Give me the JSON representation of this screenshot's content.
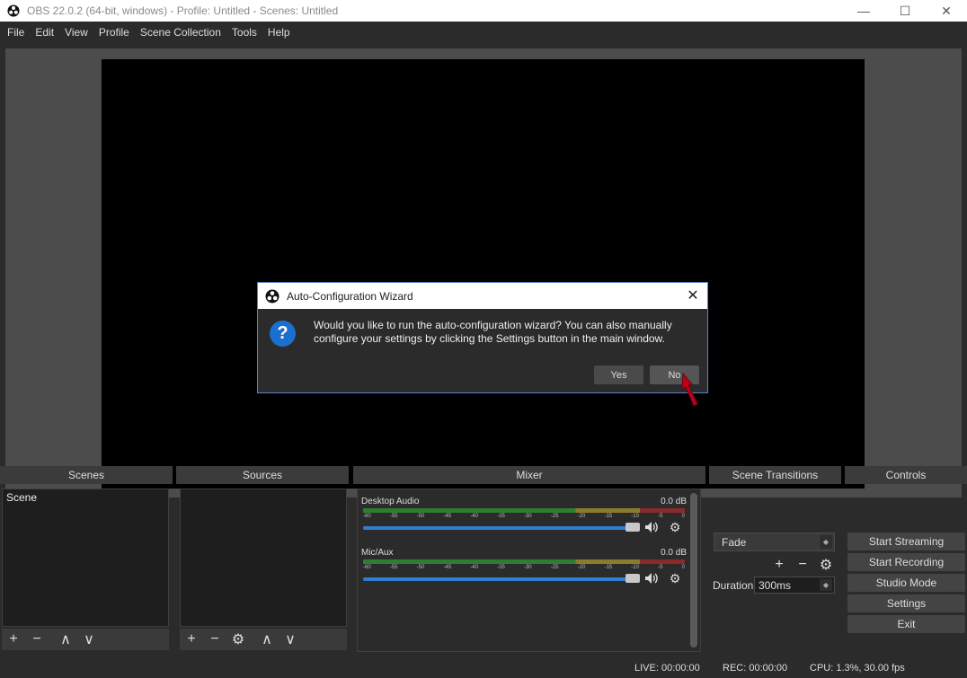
{
  "window": {
    "title": "OBS 22.0.2 (64-bit, windows) - Profile: Untitled - Scenes: Untitled",
    "minimize": "—",
    "maximize": "☐",
    "close": "✕"
  },
  "menu": [
    "File",
    "Edit",
    "View",
    "Profile",
    "Scene Collection",
    "Tools",
    "Help"
  ],
  "docks": {
    "scenes": {
      "title": "Scenes",
      "items": [
        "Scene"
      ]
    },
    "sources": {
      "title": "Sources"
    },
    "mixer": {
      "title": "Mixer"
    },
    "transitions": {
      "title": "Scene Transitions"
    },
    "controls": {
      "title": "Controls"
    }
  },
  "mixer": {
    "channels": [
      {
        "name": "Desktop Audio",
        "db": "0.0 dB",
        "volume_pct": 100
      },
      {
        "name": "Mic/Aux",
        "db": "0.0 dB",
        "volume_pct": 100
      }
    ],
    "ticks": [
      "-60",
      "-55",
      "-50",
      "-45",
      "-40",
      "-35",
      "-30",
      "-25",
      "-20",
      "-15",
      "-10",
      "-5",
      "0"
    ]
  },
  "transitions": {
    "selected": "Fade",
    "duration_label": "Duration",
    "duration_value": "300ms"
  },
  "controls": {
    "start_streaming": "Start Streaming",
    "start_recording": "Start Recording",
    "studio_mode": "Studio Mode",
    "settings": "Settings",
    "exit": "Exit"
  },
  "status": {
    "live": "LIVE: 00:00:00",
    "rec": "REC: 00:00:00",
    "cpu": "CPU: 1.3%, 30.00 fps"
  },
  "dialog": {
    "title": "Auto-Configuration Wizard",
    "line1": "Would you like to run the auto-configuration wizard?  You can also manually",
    "line2": "configure your settings by clicking the Settings button in the main window.",
    "yes": "Yes",
    "no": "No",
    "close": "✕"
  },
  "icons": {
    "plus": "+",
    "minus": "−",
    "up": "∧",
    "down": "∨",
    "gear": "⚙",
    "speaker": "🔊",
    "question": "?"
  },
  "colors": {
    "accent": "#2f7fd0",
    "dialog_border": "#5a84c6",
    "cursor": "#c0001a"
  }
}
